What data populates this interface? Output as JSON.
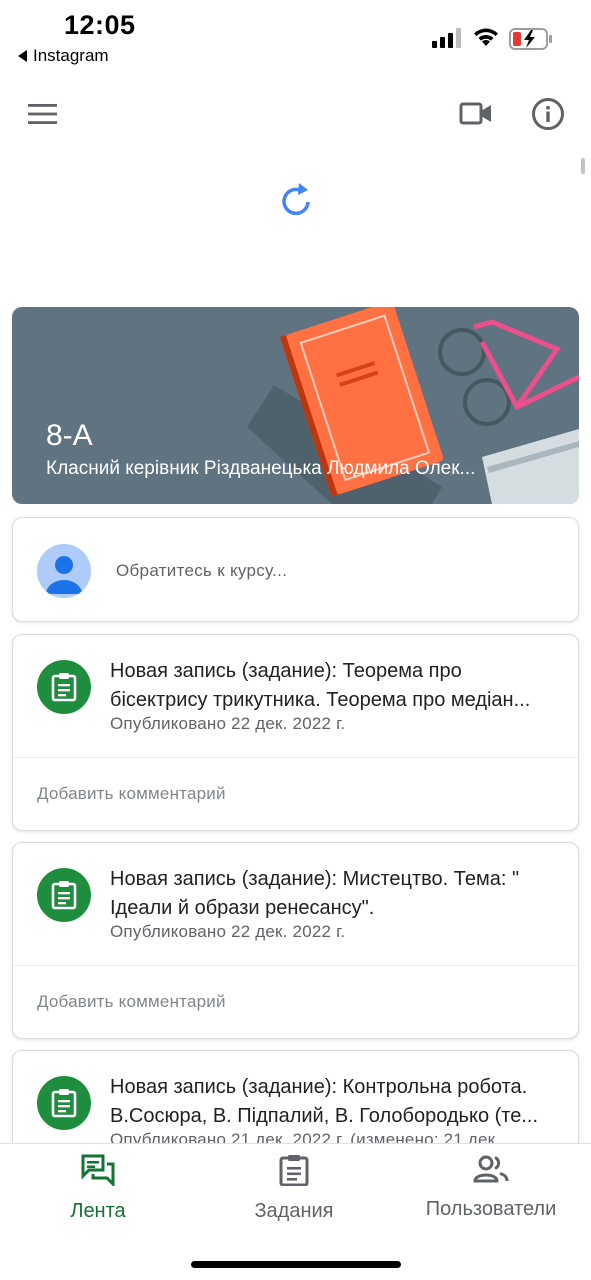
{
  "status_bar": {
    "time": "12:05",
    "back_app": "Instagram",
    "battery_color": "#e53935"
  },
  "app_bar": {
    "menu_icon": "hamburger-menu-icon",
    "video_icon": "video-camera-icon",
    "info_icon": "info-icon"
  },
  "loading": {
    "icon": "refresh-icon",
    "color": "#4285f4"
  },
  "course_banner": {
    "title": "8-A",
    "subtitle": "Класний керівник Різдванецька Людмила Олек...",
    "background": "#5f7380"
  },
  "compose": {
    "placeholder": "Обратитесь к курсу..."
  },
  "posts": [
    {
      "title_line1": "Новая запись (задание): Теорема про",
      "title_line2": "бісектрису трикутника. Теорема про медіан...",
      "date": "Опубликовано 22 дек. 2022 г.",
      "comment": "Добавить комментарий"
    },
    {
      "title_line1": "Новая запись (задание): Мистецтво. Тема: \"",
      "title_line2": "Ідеали й образи ренесансу\".",
      "date": "Опубликовано 22 дек. 2022 г.",
      "comment": "Добавить комментарий"
    },
    {
      "title_line1": "Новая запись (задание): Контрольна робота.",
      "title_line2": "В.Сосюра, В. Підпалий, В. Голобородько (те...",
      "date": "Опубликовано 21 дек. 2022 г. (изменено: 21 дек.",
      "comment": ""
    }
  ],
  "bottom_nav": {
    "items": [
      {
        "label": "Лента",
        "icon": "stream-icon",
        "active": true
      },
      {
        "label": "Задания",
        "icon": "assignment-icon",
        "active": false
      },
      {
        "label": "Пользователи",
        "icon": "people-icon",
        "active": false
      }
    ],
    "active_color": "#137333"
  }
}
